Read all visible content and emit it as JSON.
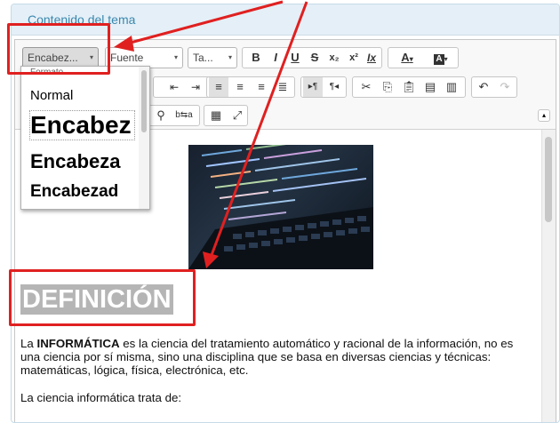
{
  "panel": {
    "title": "Contenido del tema"
  },
  "toolbar": {
    "format_combo": "Encabez...",
    "font_combo": "Fuente",
    "size_combo": "Ta...",
    "bold": "B",
    "italic": "I",
    "underline": "U",
    "strike": "S",
    "subscript": "x₂",
    "superscript": "x²",
    "remove_format": "Ix",
    "text_color": "A",
    "bg_color": "A",
    "combo_arrow": "▾"
  },
  "dropdown": {
    "caption": "Formato",
    "items": [
      "Normal",
      "Encabez",
      "Encabeza",
      "Encabezad"
    ]
  },
  "content": {
    "heading": "DEFINICIÓN",
    "para1_bold": "INFORMÁTICA",
    "para1_pre": "La ",
    "para1_rest": " es la ciencia del tratamiento automático y racional de la información, no es una ciencia por sí misma, sino una disciplina que se basa en diversas ciencias y técnicas: matemáticas, lógica, física, electrónica, etc.",
    "para2": "La ciencia informática trata de:"
  },
  "colors": {
    "annotation": "#e02020",
    "panel_header": "#e4eff7",
    "title_blue": "#3a87ad"
  }
}
